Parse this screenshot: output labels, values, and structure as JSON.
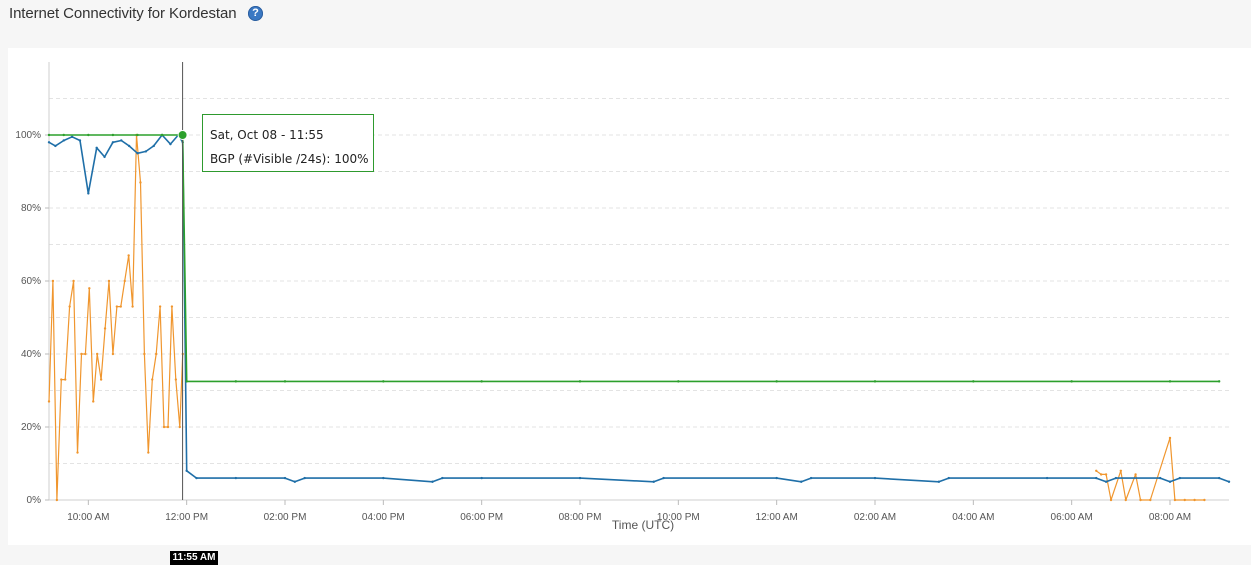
{
  "page": {
    "title": "Internet Connectivity for Kordestan",
    "help_icon": "question-icon"
  },
  "tooltip": {
    "line1": "Sat, Oct 08 - 11:55",
    "line2": "BGP (#Visible /24s): 100%"
  },
  "crosshair_label": "11:55 AM",
  "colors": {
    "bgp": "#2ca02c",
    "blue_series": "#1f6fa8",
    "orange_series": "#f0962e",
    "help_icon": "#3a78c3"
  },
  "chart_data": {
    "type": "line",
    "xlabel": "Time (UTC)",
    "ylabel": "",
    "ylim": [
      0,
      100
    ],
    "grid": true,
    "y_ticks": [
      "0%",
      "20%",
      "40%",
      "60%",
      "80%",
      "100%"
    ],
    "x_tick_labels": [
      "10:00 AM",
      "12:00 PM",
      "02:00 PM",
      "04:00 PM",
      "06:00 PM",
      "08:00 PM",
      "10:00 PM",
      "12:00 AM",
      "02:00 AM",
      "04:00 AM",
      "06:00 AM",
      "08:00 AM"
    ],
    "x_tick_hours": [
      10,
      12,
      14,
      16,
      18,
      20,
      22,
      24,
      26,
      28,
      30,
      32
    ],
    "x_range_hours": [
      9.2,
      33.2
    ],
    "series": [
      {
        "name": "BGP (#Visible /24s)",
        "points": [
          [
            9.2,
            100
          ],
          [
            9.5,
            100
          ],
          [
            10,
            100
          ],
          [
            10.5,
            100
          ],
          [
            11,
            100
          ],
          [
            11.5,
            100
          ],
          [
            11.917,
            100
          ],
          [
            12.0,
            32.5
          ],
          [
            13,
            32.5
          ],
          [
            14,
            32.5
          ],
          [
            16,
            32.5
          ],
          [
            18,
            32.5
          ],
          [
            20,
            32.5
          ],
          [
            22,
            32.5
          ],
          [
            24,
            32.5
          ],
          [
            26,
            32.5
          ],
          [
            28,
            32.5
          ],
          [
            30,
            32.5
          ],
          [
            32,
            32.5
          ],
          [
            33.0,
            32.5
          ]
        ]
      },
      {
        "points": [
          [
            9.2,
            98
          ],
          [
            9.33,
            97
          ],
          [
            9.5,
            98.5
          ],
          [
            9.67,
            99.5
          ],
          [
            9.83,
            98.5
          ],
          [
            10.0,
            84
          ],
          [
            10.17,
            96.5
          ],
          [
            10.33,
            94
          ],
          [
            10.5,
            98
          ],
          [
            10.67,
            98.5
          ],
          [
            10.83,
            97
          ],
          [
            11.0,
            95
          ],
          [
            11.17,
            95.5
          ],
          [
            11.33,
            97
          ],
          [
            11.5,
            100
          ],
          [
            11.67,
            97.5
          ],
          [
            11.83,
            100
          ],
          [
            11.92,
            98
          ],
          [
            12.0,
            8
          ],
          [
            12.2,
            6
          ],
          [
            13,
            6
          ],
          [
            14,
            6
          ],
          [
            14.2,
            5
          ],
          [
            14.4,
            6
          ],
          [
            16,
            6
          ],
          [
            17,
            5
          ],
          [
            17.2,
            6
          ],
          [
            18,
            6
          ],
          [
            20,
            6
          ],
          [
            21.5,
            5
          ],
          [
            21.7,
            6
          ],
          [
            24,
            6
          ],
          [
            24.5,
            5
          ],
          [
            24.7,
            6
          ],
          [
            26,
            6
          ],
          [
            27.3,
            5
          ],
          [
            27.5,
            6
          ],
          [
            29.5,
            6
          ],
          [
            30.5,
            6
          ],
          [
            30.7,
            5
          ],
          [
            30.9,
            6
          ],
          [
            31.8,
            6
          ],
          [
            32,
            5
          ],
          [
            32.2,
            6
          ],
          [
            33.0,
            6
          ],
          [
            33.2,
            5
          ]
        ]
      },
      {
        "points": [
          [
            9.2,
            27
          ],
          [
            9.28,
            60
          ],
          [
            9.36,
            0
          ],
          [
            9.45,
            33
          ],
          [
            9.53,
            33
          ],
          [
            9.62,
            53
          ],
          [
            9.7,
            60
          ],
          [
            9.78,
            13
          ],
          [
            9.86,
            40
          ],
          [
            9.94,
            40
          ],
          [
            10.02,
            58
          ],
          [
            10.1,
            27
          ],
          [
            10.18,
            40
          ],
          [
            10.26,
            33
          ],
          [
            10.34,
            47
          ],
          [
            10.42,
            60
          ],
          [
            10.5,
            40
          ],
          [
            10.58,
            53
          ],
          [
            10.66,
            53
          ],
          [
            10.74,
            60
          ],
          [
            10.82,
            67
          ],
          [
            10.9,
            53
          ],
          [
            10.98,
            100
          ],
          [
            11.06,
            87
          ],
          [
            11.14,
            40
          ],
          [
            11.22,
            13
          ],
          [
            11.3,
            33
          ],
          [
            11.38,
            40
          ],
          [
            11.46,
            53
          ],
          [
            11.54,
            20
          ],
          [
            11.62,
            20
          ],
          [
            11.7,
            53
          ],
          [
            11.78,
            33
          ],
          [
            11.86,
            20
          ],
          [
            11.92,
            40
          ],
          [
            30.5,
            8
          ],
          [
            30.6,
            7
          ],
          [
            30.7,
            7
          ],
          [
            30.8,
            0
          ],
          [
            31.0,
            8
          ],
          [
            31.1,
            0
          ],
          [
            31.3,
            7
          ],
          [
            31.4,
            0
          ],
          [
            31.6,
            0
          ],
          [
            32.0,
            17
          ],
          [
            32.1,
            0
          ],
          [
            32.3,
            0
          ],
          [
            32.5,
            0
          ],
          [
            32.7,
            0
          ]
        ]
      }
    ]
  }
}
